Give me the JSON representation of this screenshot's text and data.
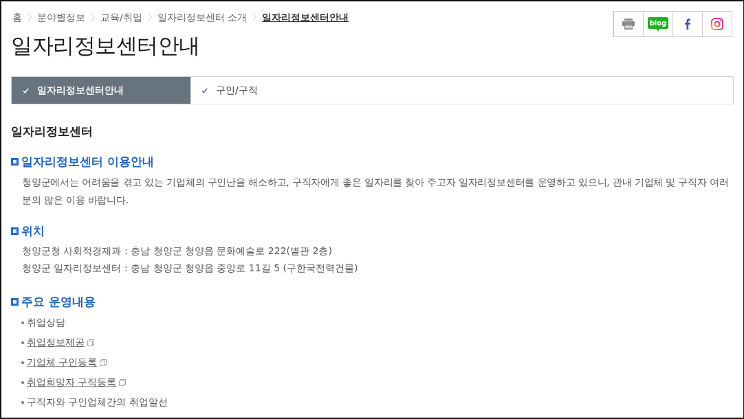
{
  "breadcrumb": [
    {
      "label": "홈",
      "current": false
    },
    {
      "label": "분야별정보",
      "current": false
    },
    {
      "label": "교육/취업",
      "current": false
    },
    {
      "label": "일자리정보센터 소개",
      "current": false
    },
    {
      "label": "일자리정보센터안내",
      "current": true
    }
  ],
  "share_buttons": [
    {
      "kind": "print"
    },
    {
      "kind": "blog",
      "label": "blog"
    },
    {
      "kind": "facebook"
    },
    {
      "kind": "instagram"
    }
  ],
  "title": "일자리정보센터안내",
  "tabs": [
    {
      "label": "일자리정보센터안내",
      "selected": true
    },
    {
      "label": "구인/구직",
      "selected": false
    }
  ],
  "section_title": "일자리정보센터",
  "sections": [
    {
      "kind": "paragraph",
      "heading": "일자리정보센터 이용안내",
      "text": "청양군에서는 어려움을 겪고 있는 기업체의 구인난을 해소하고, 구직자에게 좋은 일자리를 찾아 주고자 일자리정보센터를 운영하고 있으니, 관내 기업체 및 구직자 여러분의 많은 이용 바랍니다."
    },
    {
      "kind": "lines",
      "heading": "위치",
      "lines": [
        "청양군청 사회적경제과 : 충남 청양군 청양읍 문화예술로 222(별관 2층)",
        "청양군 일자리정보센터 : 충남 청양군 청양읍 중앙로 11길 5 (구한국전력건물)"
      ]
    },
    {
      "kind": "list",
      "heading": "주요 운영내용",
      "items": [
        {
          "text": "취업상담",
          "link": false
        },
        {
          "text": "취업정보제공",
          "link": true
        },
        {
          "text": "기업체 구인등록",
          "link": true
        },
        {
          "text": "취업희망자 구직등록",
          "link": true
        },
        {
          "text": "구직자와 구인업체간의 취업알선",
          "link": false
        }
      ]
    }
  ]
}
